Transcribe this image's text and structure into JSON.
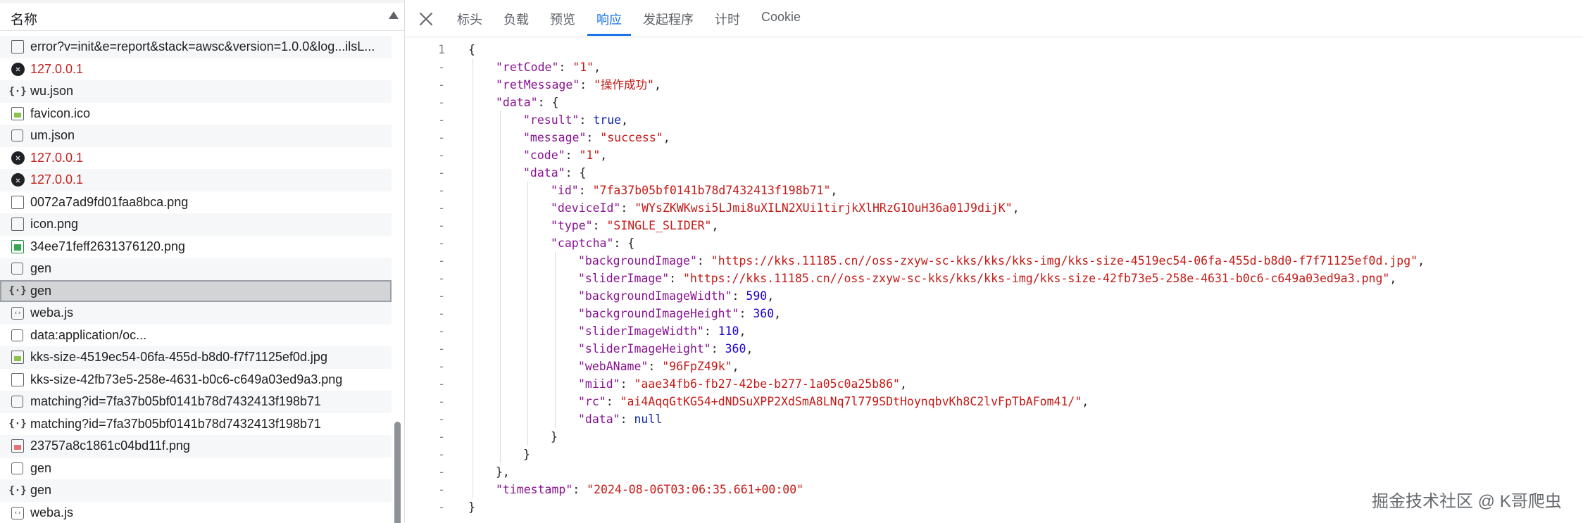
{
  "left_panel": {
    "header_title": "名称",
    "rows": [
      {
        "icon": "document-icon",
        "name": "error?v=init&e=report&stack=awsc&version=1.0.0&log...ilsL...",
        "status": "ok"
      },
      {
        "icon": "error-icon",
        "name": "127.0.0.1",
        "status": "error"
      },
      {
        "icon": "json-icon",
        "name": "wu.json",
        "status": "ok"
      },
      {
        "icon": "image-icon",
        "name": "favicon.ico",
        "status": "ok"
      },
      {
        "icon": "blank-file-icon",
        "name": "um.json",
        "status": "ok"
      },
      {
        "icon": "error-icon",
        "name": "127.0.0.1",
        "status": "error"
      },
      {
        "icon": "error-icon",
        "name": "127.0.0.1",
        "status": "error"
      },
      {
        "icon": "document-icon",
        "name": "0072a7ad9fd01faa8bca.png",
        "status": "ok"
      },
      {
        "icon": "document-icon",
        "name": "icon.png",
        "status": "ok"
      },
      {
        "icon": "image-icon-green",
        "name": "34ee71feff2631376120.png",
        "status": "ok"
      },
      {
        "icon": "blank-file-icon",
        "name": "gen",
        "status": "ok"
      },
      {
        "icon": "json-icon",
        "name": "gen",
        "status": "selected"
      },
      {
        "icon": "script-icon",
        "name": "weba.js",
        "status": "ok"
      },
      {
        "icon": "blank-file-icon",
        "name": "data:application/oc...",
        "status": "ok"
      },
      {
        "icon": "image-icon",
        "name": "kks-size-4519ec54-06fa-455d-b8d0-f7f71125ef0d.jpg",
        "status": "ok"
      },
      {
        "icon": "document-icon",
        "name": "kks-size-42fb73e5-258e-4631-b0c6-c649a03ed9a3.png",
        "status": "ok"
      },
      {
        "icon": "blank-file-icon",
        "name": "matching?id=7fa37b05bf0141b78d7432413f198b71",
        "status": "ok"
      },
      {
        "icon": "json-icon",
        "name": "matching?id=7fa37b05bf0141b78d7432413f198b71",
        "status": "ok"
      },
      {
        "icon": "image-icon-red",
        "name": "23757a8c1861c04bd11f.png",
        "status": "ok"
      },
      {
        "icon": "blank-file-icon",
        "name": "gen",
        "status": "ok"
      },
      {
        "icon": "json-icon",
        "name": "gen",
        "status": "ok"
      },
      {
        "icon": "script-icon",
        "name": "weba.js",
        "status": "ok"
      }
    ]
  },
  "right_panel": {
    "tabs": [
      "标头",
      "负载",
      "预览",
      "响应",
      "发起程序",
      "计时",
      "Cookie"
    ],
    "active_tab": "响应",
    "first_line_number": "1",
    "fold_marker": "-",
    "code_lines": [
      {
        "indent": 0,
        "parts": [
          {
            "t": "p",
            "v": "{"
          }
        ]
      },
      {
        "indent": 1,
        "parts": [
          {
            "t": "k",
            "v": "\"retCode\""
          },
          {
            "t": "p",
            "v": ": "
          },
          {
            "t": "s",
            "v": "\"1\""
          },
          {
            "t": "p",
            "v": ","
          }
        ]
      },
      {
        "indent": 1,
        "parts": [
          {
            "t": "k",
            "v": "\"retMessage\""
          },
          {
            "t": "p",
            "v": ": "
          },
          {
            "t": "s",
            "v": "\"操作成功\""
          },
          {
            "t": "p",
            "v": ","
          }
        ]
      },
      {
        "indent": 1,
        "parts": [
          {
            "t": "k",
            "v": "\"data\""
          },
          {
            "t": "p",
            "v": ": {"
          }
        ]
      },
      {
        "indent": 2,
        "parts": [
          {
            "t": "k",
            "v": "\"result\""
          },
          {
            "t": "p",
            "v": ": "
          },
          {
            "t": "b",
            "v": "true"
          },
          {
            "t": "p",
            "v": ","
          }
        ]
      },
      {
        "indent": 2,
        "parts": [
          {
            "t": "k",
            "v": "\"message\""
          },
          {
            "t": "p",
            "v": ": "
          },
          {
            "t": "s",
            "v": "\"success\""
          },
          {
            "t": "p",
            "v": ","
          }
        ]
      },
      {
        "indent": 2,
        "parts": [
          {
            "t": "k",
            "v": "\"code\""
          },
          {
            "t": "p",
            "v": ": "
          },
          {
            "t": "s",
            "v": "\"1\""
          },
          {
            "t": "p",
            "v": ","
          }
        ]
      },
      {
        "indent": 2,
        "parts": [
          {
            "t": "k",
            "v": "\"data\""
          },
          {
            "t": "p",
            "v": ": {"
          }
        ]
      },
      {
        "indent": 3,
        "parts": [
          {
            "t": "k",
            "v": "\"id\""
          },
          {
            "t": "p",
            "v": ": "
          },
          {
            "t": "s",
            "v": "\"7fa37b05bf0141b78d7432413f198b71\""
          },
          {
            "t": "p",
            "v": ","
          }
        ]
      },
      {
        "indent": 3,
        "parts": [
          {
            "t": "k",
            "v": "\"deviceId\""
          },
          {
            "t": "p",
            "v": ": "
          },
          {
            "t": "s",
            "v": "\"WYsZKWKwsi5LJmi8uXILN2XUi1tirjkXlHRzG1OuH36a01J9dijK\""
          },
          {
            "t": "p",
            "v": ","
          }
        ]
      },
      {
        "indent": 3,
        "parts": [
          {
            "t": "k",
            "v": "\"type\""
          },
          {
            "t": "p",
            "v": ": "
          },
          {
            "t": "s",
            "v": "\"SINGLE_SLIDER\""
          },
          {
            "t": "p",
            "v": ","
          }
        ]
      },
      {
        "indent": 3,
        "parts": [
          {
            "t": "k",
            "v": "\"captcha\""
          },
          {
            "t": "p",
            "v": ": {"
          }
        ]
      },
      {
        "indent": 4,
        "parts": [
          {
            "t": "k",
            "v": "\"backgroundImage\""
          },
          {
            "t": "p",
            "v": ": "
          },
          {
            "t": "s",
            "v": "\"https://kks.11185.cn//oss-zxyw-sc-kks/kks/kks-img/kks-size-4519ec54-06fa-455d-b8d0-f7f71125ef0d.jpg\""
          },
          {
            "t": "p",
            "v": ","
          }
        ]
      },
      {
        "indent": 4,
        "parts": [
          {
            "t": "k",
            "v": "\"sliderImage\""
          },
          {
            "t": "p",
            "v": ": "
          },
          {
            "t": "s",
            "v": "\"https://kks.11185.cn//oss-zxyw-sc-kks/kks/kks-img/kks-size-42fb73e5-258e-4631-b0c6-c649a03ed9a3.png\""
          },
          {
            "t": "p",
            "v": ","
          }
        ]
      },
      {
        "indent": 4,
        "parts": [
          {
            "t": "k",
            "v": "\"backgroundImageWidth\""
          },
          {
            "t": "p",
            "v": ": "
          },
          {
            "t": "n",
            "v": "590"
          },
          {
            "t": "p",
            "v": ","
          }
        ]
      },
      {
        "indent": 4,
        "parts": [
          {
            "t": "k",
            "v": "\"backgroundImageHeight\""
          },
          {
            "t": "p",
            "v": ": "
          },
          {
            "t": "n",
            "v": "360"
          },
          {
            "t": "p",
            "v": ","
          }
        ]
      },
      {
        "indent": 4,
        "parts": [
          {
            "t": "k",
            "v": "\"sliderImageWidth\""
          },
          {
            "t": "p",
            "v": ": "
          },
          {
            "t": "n",
            "v": "110"
          },
          {
            "t": "p",
            "v": ","
          }
        ]
      },
      {
        "indent": 4,
        "parts": [
          {
            "t": "k",
            "v": "\"sliderImageHeight\""
          },
          {
            "t": "p",
            "v": ": "
          },
          {
            "t": "n",
            "v": "360"
          },
          {
            "t": "p",
            "v": ","
          }
        ]
      },
      {
        "indent": 4,
        "parts": [
          {
            "t": "k",
            "v": "\"webAName\""
          },
          {
            "t": "p",
            "v": ": "
          },
          {
            "t": "s",
            "v": "\"96FpZ49k\""
          },
          {
            "t": "p",
            "v": ","
          }
        ]
      },
      {
        "indent": 4,
        "parts": [
          {
            "t": "k",
            "v": "\"miid\""
          },
          {
            "t": "p",
            "v": ": "
          },
          {
            "t": "s",
            "v": "\"aae34fb6-fb27-42be-b277-1a05c0a25b86\""
          },
          {
            "t": "p",
            "v": ","
          }
        ]
      },
      {
        "indent": 4,
        "parts": [
          {
            "t": "k",
            "v": "\"rc\""
          },
          {
            "t": "p",
            "v": ": "
          },
          {
            "t": "s",
            "v": "\"ai4AqqGtKG54+dNDSuXPP2XdSmA8LNq7l779SDtHoynqbvKh8C2lvFpTbAFom41/\""
          },
          {
            "t": "p",
            "v": ","
          }
        ]
      },
      {
        "indent": 4,
        "parts": [
          {
            "t": "k",
            "v": "\"data\""
          },
          {
            "t": "p",
            "v": ": "
          },
          {
            "t": "b",
            "v": "null"
          }
        ]
      },
      {
        "indent": 3,
        "parts": [
          {
            "t": "p",
            "v": "}"
          }
        ]
      },
      {
        "indent": 2,
        "parts": [
          {
            "t": "p",
            "v": "}"
          }
        ]
      },
      {
        "indent": 1,
        "parts": [
          {
            "t": "p",
            "v": "},"
          }
        ]
      },
      {
        "indent": 1,
        "parts": [
          {
            "t": "k",
            "v": "\"timestamp\""
          },
          {
            "t": "p",
            "v": ": "
          },
          {
            "t": "s",
            "v": "\"2024-08-06T03:06:35.661+00:00\""
          }
        ]
      },
      {
        "indent": 0,
        "parts": [
          {
            "t": "p",
            "v": "}"
          }
        ]
      }
    ]
  },
  "watermark": "掘金技术社区 @ K哥爬虫"
}
